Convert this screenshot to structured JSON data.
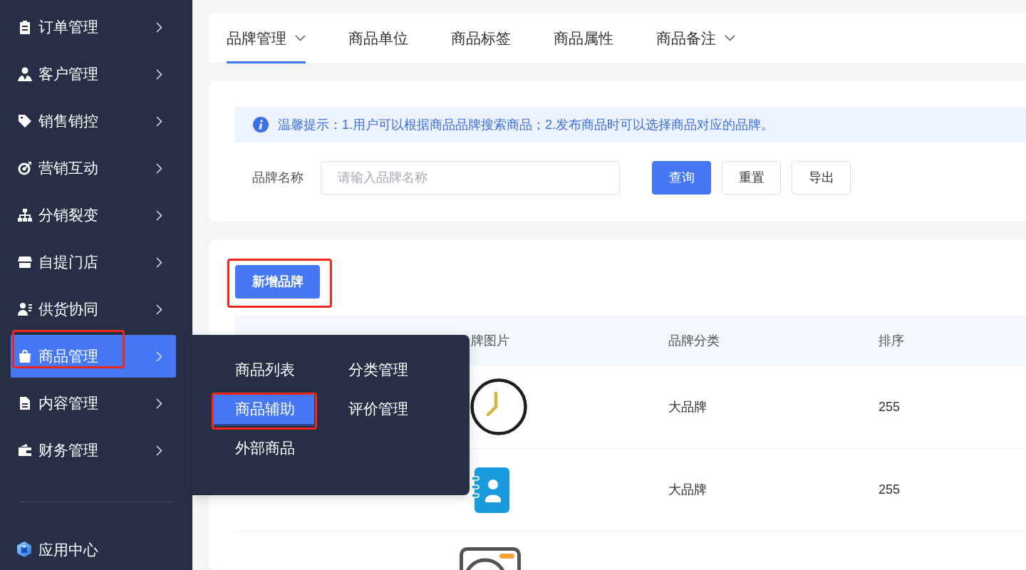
{
  "sidebar": {
    "items": [
      {
        "label": "订单管理",
        "selected": false,
        "highlighted": false
      },
      {
        "label": "客户管理",
        "selected": false,
        "highlighted": false
      },
      {
        "label": "销售销控",
        "selected": false,
        "highlighted": false
      },
      {
        "label": "营销互动",
        "selected": false,
        "highlighted": false
      },
      {
        "label": "分销裂变",
        "selected": false,
        "highlighted": false
      },
      {
        "label": "自提门店",
        "selected": false,
        "highlighted": false
      },
      {
        "label": "供货协同",
        "selected": false,
        "highlighted": false
      },
      {
        "label": "商品管理",
        "selected": true,
        "highlighted": true
      },
      {
        "label": "内容管理",
        "selected": false,
        "highlighted": false
      },
      {
        "label": "财务管理",
        "selected": false,
        "highlighted": false
      }
    ],
    "footer_item": {
      "label": "应用中心"
    }
  },
  "submenu": {
    "items": [
      {
        "label": "商品列表",
        "selected": false,
        "highlighted": false
      },
      {
        "label": "分类管理",
        "selected": false,
        "highlighted": false
      },
      {
        "label": "商品辅助",
        "selected": true,
        "highlighted": true
      },
      {
        "label": "评价管理",
        "selected": false,
        "highlighted": false
      },
      {
        "label": "外部商品",
        "selected": false,
        "highlighted": false
      }
    ]
  },
  "tabs": [
    {
      "label": "品牌管理",
      "selected": true,
      "dropdown": true
    },
    {
      "label": "商品单位",
      "selected": false,
      "dropdown": false
    },
    {
      "label": "商品标签",
      "selected": false,
      "dropdown": false
    },
    {
      "label": "商品属性",
      "selected": false,
      "dropdown": false
    },
    {
      "label": "商品备注",
      "selected": false,
      "dropdown": true
    }
  ],
  "notice": {
    "text": "温馨提示：1.用户可以根据商品品牌搜索商品；2.发布商品时可以选择商品对应的品牌。"
  },
  "search_form": {
    "label": "品牌名称",
    "placeholder": "请输入品牌名称",
    "buttons": [
      {
        "label": "查询",
        "kind": "primary"
      },
      {
        "label": "重置",
        "kind": "default"
      },
      {
        "label": "导出",
        "kind": "default"
      }
    ]
  },
  "add_button": {
    "label": "新增品牌",
    "highlighted": true
  },
  "table": {
    "columns": [
      "牌图片",
      "品牌分类",
      "排序"
    ],
    "rows": [
      {
        "kind": "full",
        "category": "大品牌",
        "sort": "255"
      },
      {
        "kind": "full",
        "category": "大品牌",
        "sort": "255"
      },
      {
        "kind": "clipped"
      }
    ]
  }
}
